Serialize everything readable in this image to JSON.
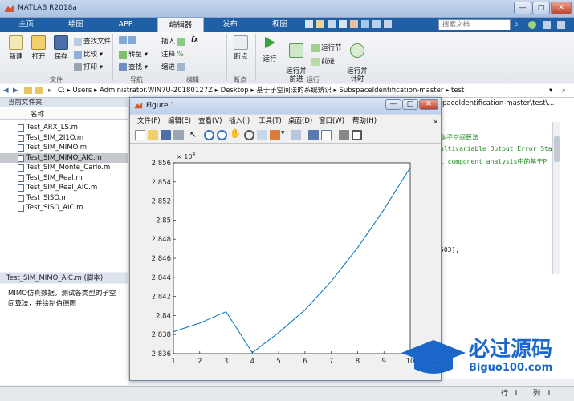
{
  "window": {
    "title": "MATLAB R2018a",
    "min": "—",
    "max": "□",
    "close": "✕"
  },
  "tabs": [
    "主页",
    "绘图",
    "APP",
    "编辑器",
    "发布",
    "视图"
  ],
  "active_tab": "编辑器",
  "search_placeholder": "搜索文档",
  "ribbon": {
    "file": {
      "new": "新建",
      "open": "打开",
      "save": "保存",
      "find_files": "查找文件",
      "compare": "比较",
      "print": "打印",
      "group": "文件"
    },
    "nav": {
      "goto": "转至",
      "find": "查找",
      "group": "导航"
    },
    "edit": {
      "insert": "插入",
      "fx": "fx",
      "comment": "注释",
      "indent": "缩进",
      "group": "编辑"
    },
    "breakpoints": {
      "label": "断点",
      "group": "断点"
    },
    "run": {
      "run": "运行",
      "run_advance": "运行并\n前进",
      "run_section": "运行节",
      "advance": "前进",
      "run_time": "运行并\n计时",
      "group": "运行"
    }
  },
  "address": [
    "C:",
    "Users",
    "Administrator.WIN7U-20180127Z",
    "Desktop",
    "基于子空间法的系统辨识",
    "SubspaceIdentification-master",
    "test"
  ],
  "current_folder": {
    "title": "当前文件夹",
    "col_name": "名称",
    "files": [
      "Test_ARX_LS.m",
      "Test_SIM_2I1O.m",
      "Test_SIM_MIMO.m",
      "Test_SIM_MIMO_AIC.m",
      "Test_SIM_Monte_Carlo.m",
      "Test_SIM_Real.m",
      "Test_SIM_Real_AIC.m",
      "Test_SISO.m",
      "Test_SISO_AIC.m"
    ],
    "selected": "Test_SIM_MIMO_AIC.m"
  },
  "details": {
    "header": "Test_SIM_MIMO_AIC.m (脚本)",
    "text": "MIMO仿真数据，测试各类型的子空间算法，并绘制伯德图"
  },
  "editor": {
    "path": "paceIdentification-master\\test\\...",
    "lines": [
      "本子空间算法",
      "ultivariable Output Error Sta",
      "l component analysis中的基于P",
      "503];"
    ]
  },
  "figure": {
    "title": "Figure 1",
    "menu": [
      "文件(F)",
      "编辑(E)",
      "查看(V)",
      "插入(I)",
      "工具(T)",
      "桌面(D)",
      "窗口(W)",
      "帮助(H)"
    ]
  },
  "status": {
    "row_label": "行",
    "row": "1",
    "col_label": "列",
    "col": "1"
  },
  "watermark": {
    "brand": "必过源码",
    "site": "Biguo100.com"
  },
  "chart_data": {
    "type": "line",
    "x": [
      1,
      2,
      3,
      4,
      5,
      6,
      7,
      8,
      9,
      10
    ],
    "y": [
      2.8383,
      2.8392,
      2.8404,
      2.8361,
      2.8382,
      2.8406,
      2.8436,
      2.8471,
      2.8511,
      2.8555
    ],
    "xlim": [
      1,
      10
    ],
    "ylim": [
      2.836,
      2.856
    ],
    "xticks": [
      "1",
      "2",
      "3",
      "4",
      "5",
      "6",
      "7",
      "8",
      "9",
      "10"
    ],
    "yticks": [
      "2.836",
      "2.838",
      "2.84",
      "2.842",
      "2.844",
      "2.846",
      "2.848",
      "2.85",
      "2.852",
      "2.854",
      "2.856"
    ],
    "exponent_base": "× 10",
    "exponent_power": "4",
    "color": "#0072bd",
    "grid": false
  }
}
